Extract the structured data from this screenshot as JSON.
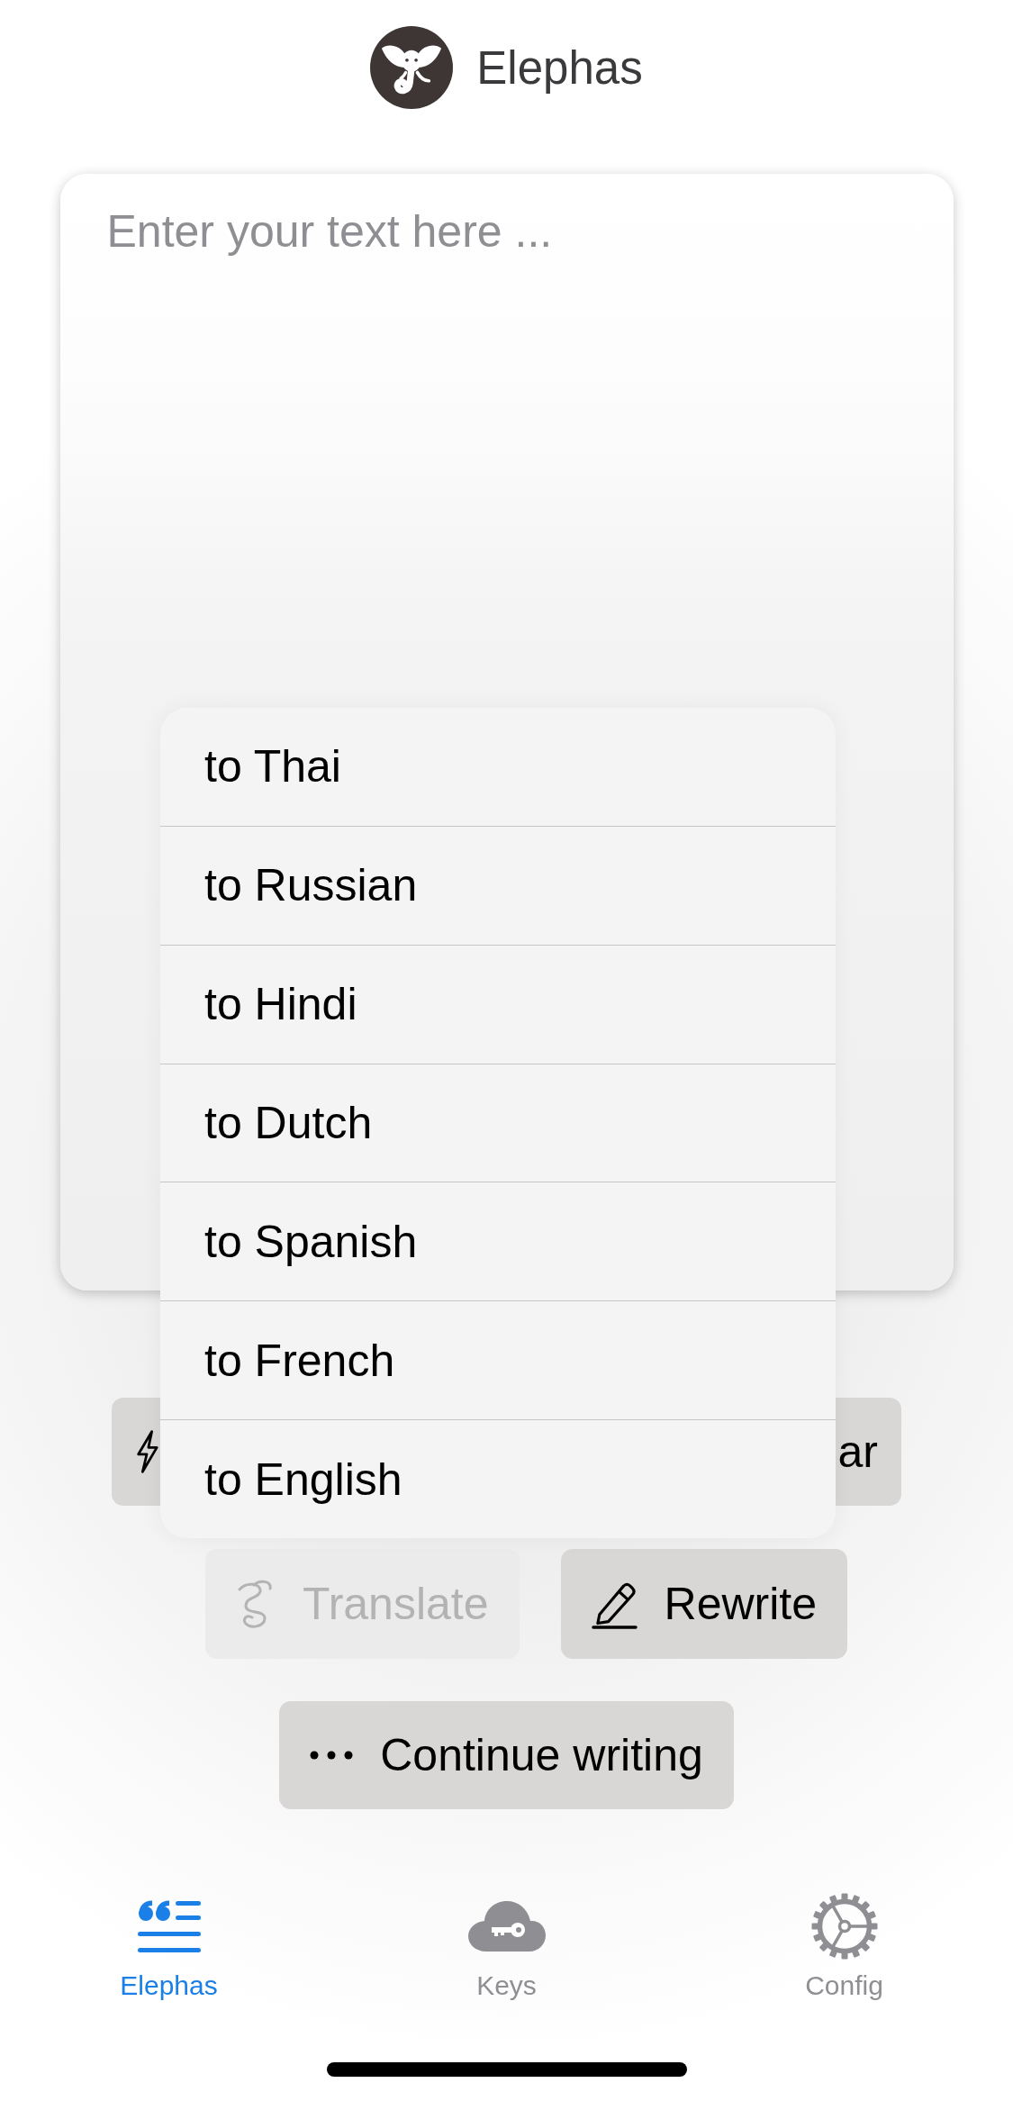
{
  "header": {
    "title": "Elephas"
  },
  "editor": {
    "placeholder": "Enter your text here ..."
  },
  "covered_buttons": [
    {
      "kind": "lightning"
    },
    {
      "kind": "label",
      "label": "ar"
    }
  ],
  "action_rows": [
    [
      {
        "kind": "translate",
        "label": "Translate",
        "disabled": true
      },
      {
        "kind": "rewrite",
        "label": "Rewrite",
        "disabled": false
      }
    ],
    [
      {
        "kind": "continue",
        "label": "Continue writing",
        "disabled": false
      }
    ]
  ],
  "menu": {
    "items": [
      {
        "label": "to Thai"
      },
      {
        "label": "to Russian"
      },
      {
        "label": "to Hindi"
      },
      {
        "label": "to Dutch"
      },
      {
        "label": "to Spanish"
      },
      {
        "label": "to French"
      },
      {
        "label": "to English"
      }
    ]
  },
  "tab_bar": {
    "tabs": [
      {
        "kind": "compose",
        "label": "Elephas",
        "selected": true
      },
      {
        "kind": "keys",
        "label": "Keys",
        "selected": false
      },
      {
        "kind": "settings",
        "label": "Config",
        "selected": false
      }
    ]
  }
}
